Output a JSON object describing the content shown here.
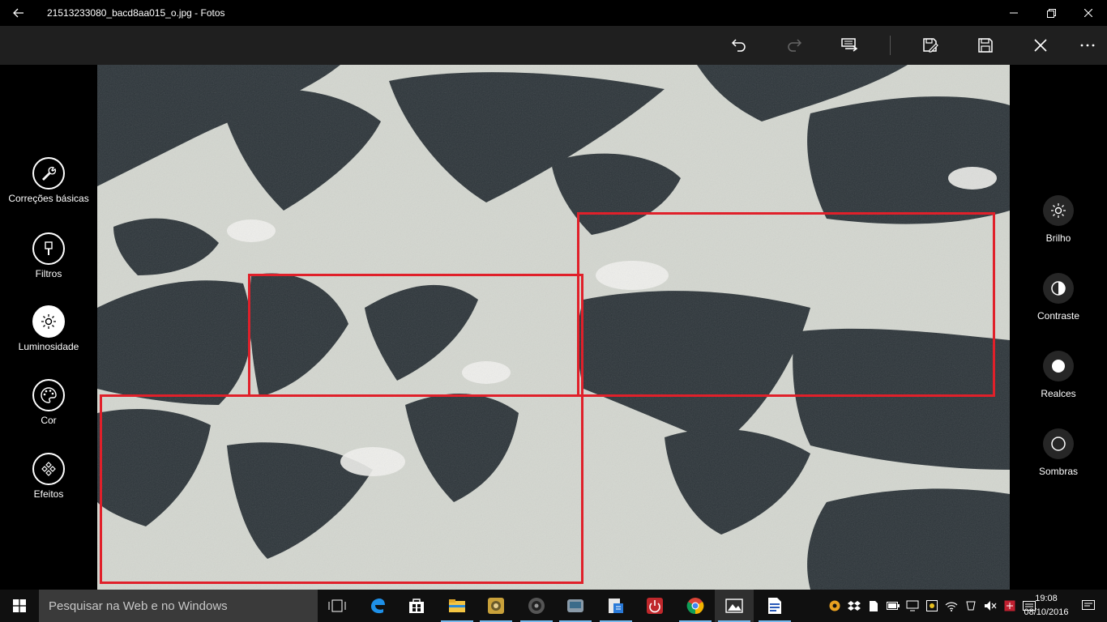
{
  "window": {
    "title": "21513233080_bacd8aa015_o.jpg - Fotos",
    "back_icon": "back-arrow-icon",
    "controls": [
      "minimize-icon",
      "restore-icon",
      "close-icon"
    ]
  },
  "toolbar": {
    "items": [
      {
        "name": "undo",
        "icon": "undo-icon",
        "enabled": true
      },
      {
        "name": "redo",
        "icon": "redo-icon",
        "enabled": false
      },
      {
        "name": "compare",
        "icon": "compare-icon",
        "enabled": true
      },
      {
        "name": "save-copy",
        "icon": "save-copy-icon",
        "enabled": true
      },
      {
        "name": "save",
        "icon": "save-icon",
        "enabled": true
      },
      {
        "name": "cancel",
        "icon": "close-icon",
        "enabled": true
      },
      {
        "name": "more",
        "icon": "more-icon",
        "enabled": true
      }
    ]
  },
  "left_panel": {
    "items": [
      {
        "label": "Correções básicas",
        "icon": "wrench-icon",
        "active": false
      },
      {
        "label": "Filtros",
        "icon": "brush-icon",
        "active": false
      },
      {
        "label": "Luminosidade",
        "icon": "sun-icon",
        "active": true
      },
      {
        "label": "Cor",
        "icon": "palette-icon",
        "active": false
      },
      {
        "label": "Efeitos",
        "icon": "effects-icon",
        "active": false
      }
    ]
  },
  "right_panel": {
    "items": [
      {
        "label": "Brilho",
        "icon": "brightness-icon"
      },
      {
        "label": "Contraste",
        "icon": "contrast-icon"
      },
      {
        "label": "Realces",
        "icon": "highlights-icon"
      },
      {
        "label": "Sombras",
        "icon": "shadows-icon"
      }
    ]
  },
  "photo": {
    "description_icon": "lunar-surface-photo",
    "highlight_color": "#e0202a"
  },
  "taskbar": {
    "search_placeholder": "Pesquisar na Web e no Windows",
    "apps": [
      "task-view-icon",
      "edge-icon",
      "store-icon",
      "file-explorer-icon",
      "app-icon",
      "speaker-app-icon",
      "app-icon",
      "app-icon",
      "power-app-icon",
      "chrome-icon",
      "photos-icon",
      "document-icon"
    ],
    "clock_time": "19:08",
    "clock_date": "08/10/2016"
  },
  "colors": {
    "toolbar_bg": "#1f1f1f",
    "accent": "#76b9ed",
    "selection_red": "#e0202a"
  }
}
